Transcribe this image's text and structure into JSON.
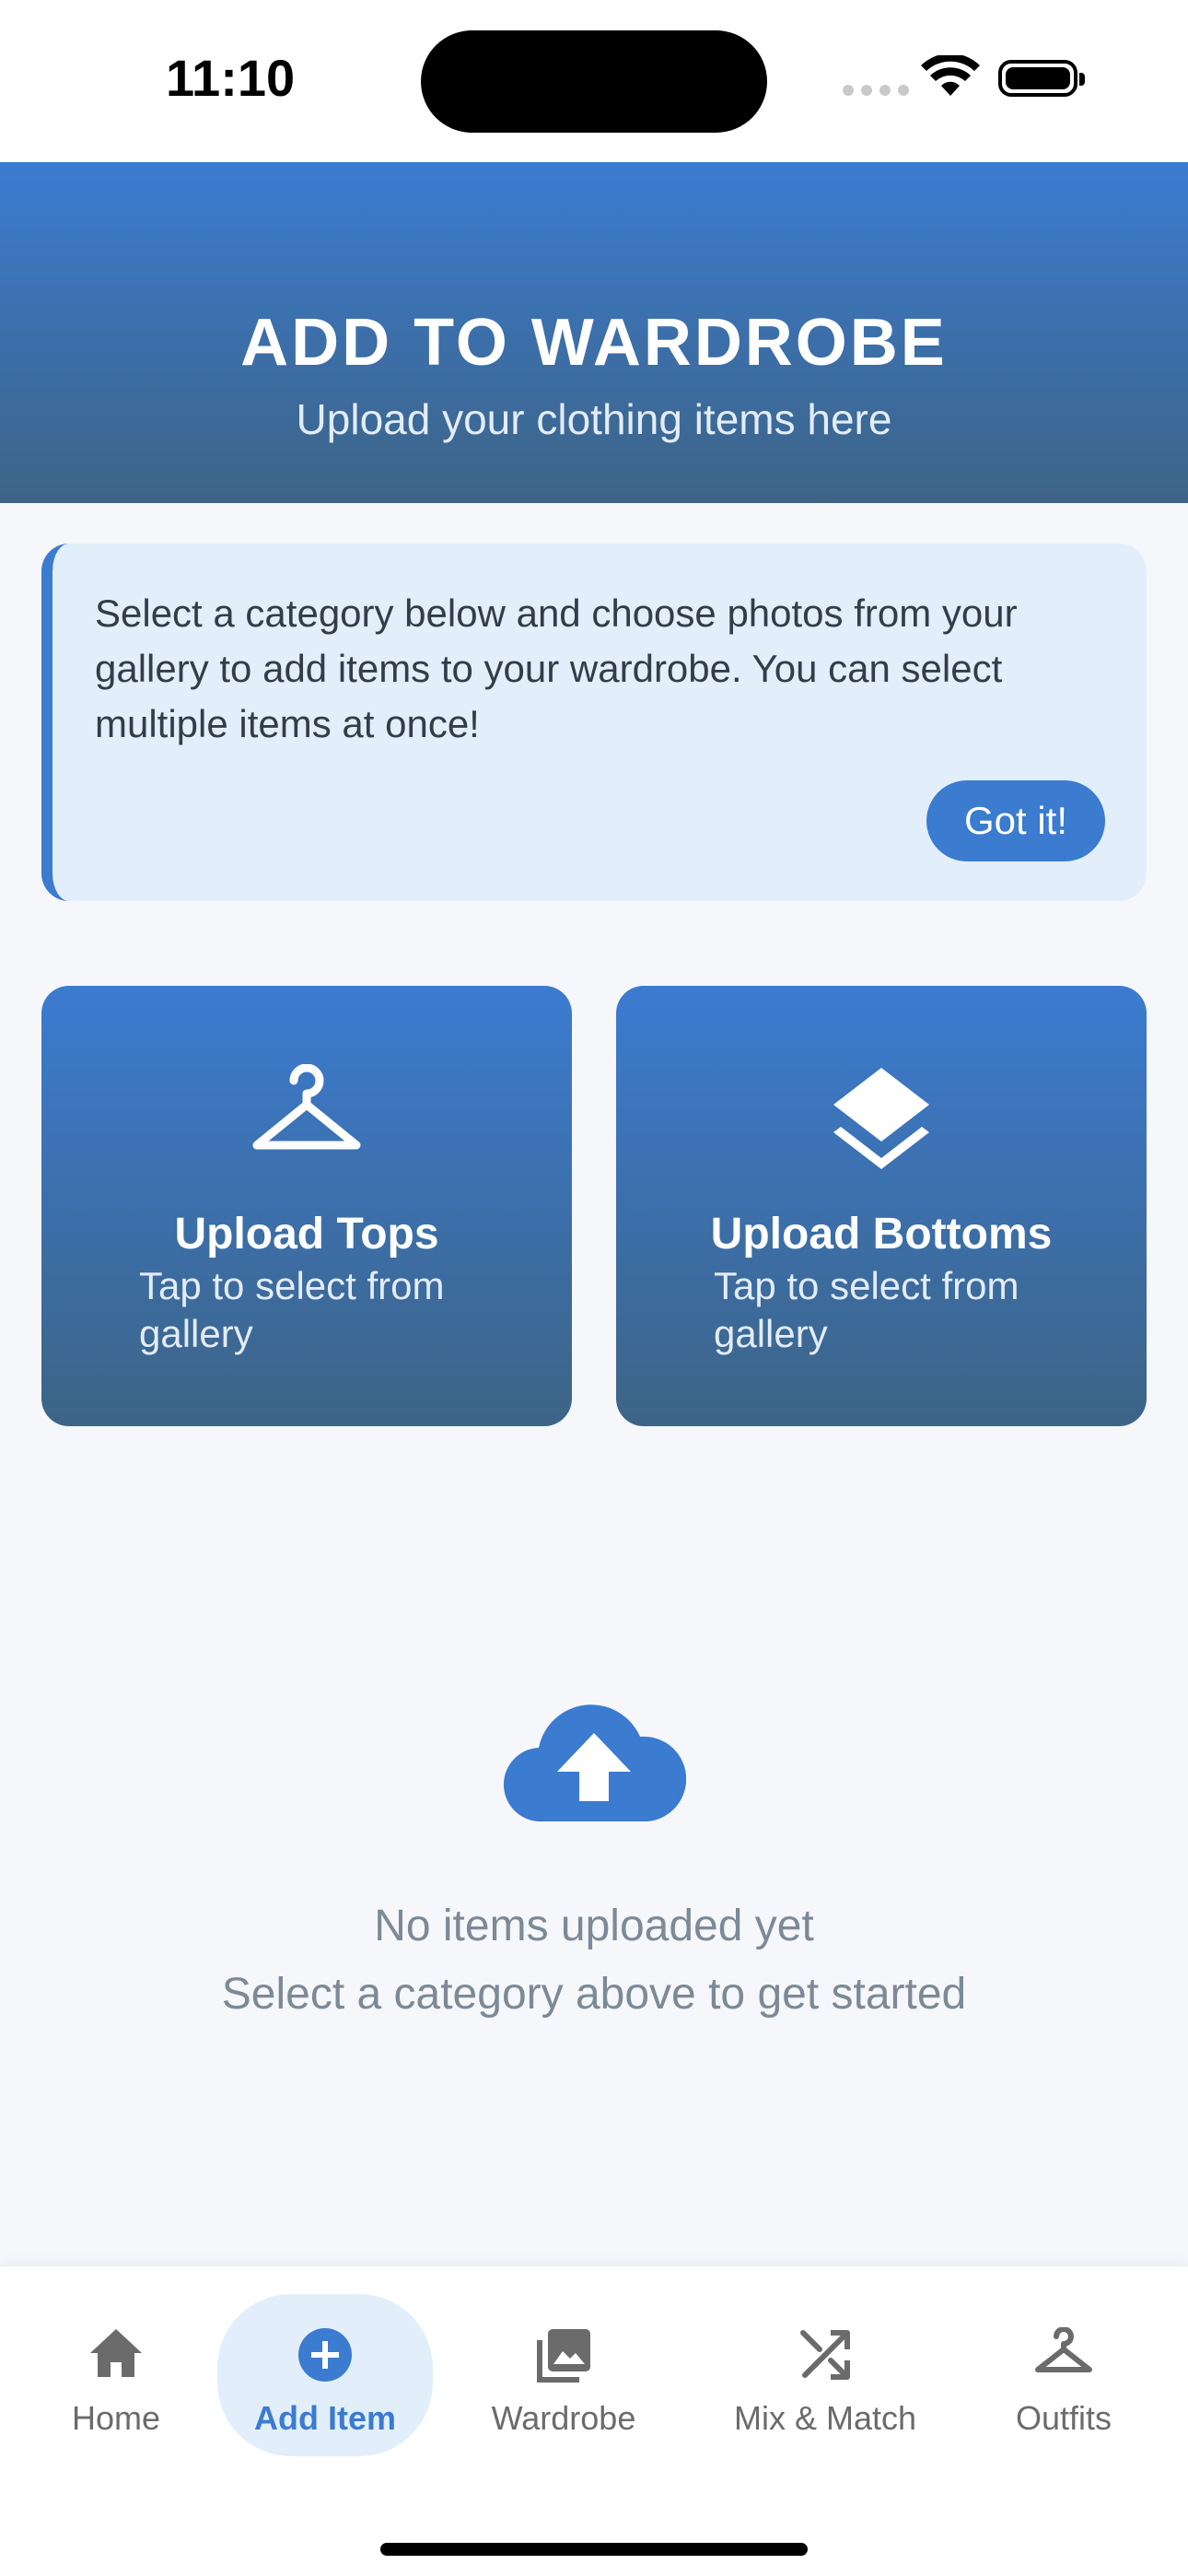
{
  "status_bar": {
    "time": "11:10"
  },
  "header": {
    "title": "ADD TO WARDROBE",
    "subtitle": "Upload your clothing items here",
    "gradient_top": "#3b7bd0",
    "gradient_bottom": "#3d6486"
  },
  "info_card": {
    "message": "Select a category below and choose photos from your gallery to add items to your wardrobe. You can select multiple items at once!",
    "button_label": "Got it!"
  },
  "upload_cards": [
    {
      "icon": "hanger-icon",
      "title": "Upload Tops",
      "subtitle": "Tap to select from gallery"
    },
    {
      "icon": "layers-icon",
      "title": "Upload Bottoms",
      "subtitle": "Tap to select from gallery"
    }
  ],
  "empty_state": {
    "icon": "cloud-upload-icon",
    "line1": "No items uploaded yet",
    "line2": "Select a category above to get started"
  },
  "bottom_nav": {
    "active": "Add Item",
    "accent_color": "#3b7bd0",
    "items": [
      {
        "icon": "home-icon",
        "label": "Home"
      },
      {
        "icon": "add-circle-icon",
        "label": "Add Item"
      },
      {
        "icon": "photo-library-icon",
        "label": "Wardrobe"
      },
      {
        "icon": "shuffle-icon",
        "label": "Mix & Match"
      },
      {
        "icon": "hanger-icon",
        "label": "Outfits"
      }
    ]
  }
}
